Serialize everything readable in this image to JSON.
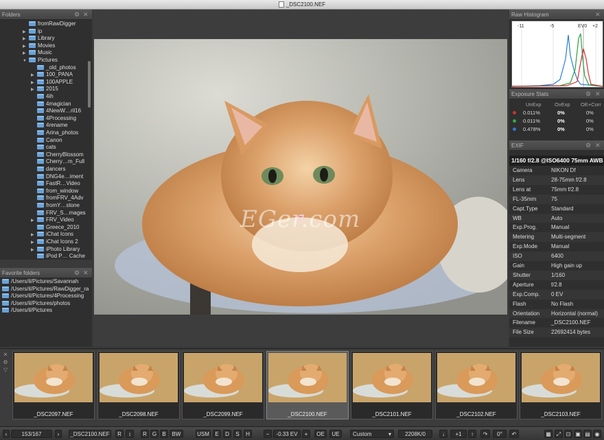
{
  "window": {
    "title": "_DSC2100.NEF"
  },
  "folders_panel": {
    "title": "Folders",
    "items": [
      {
        "label": "fromRawDigger",
        "depth": 1,
        "arrow": ""
      },
      {
        "label": "ip",
        "depth": 1,
        "arrow": "▶"
      },
      {
        "label": "Library",
        "depth": 1,
        "arrow": "▶"
      },
      {
        "label": "Movies",
        "depth": 1,
        "arrow": "▶"
      },
      {
        "label": "Music",
        "depth": 1,
        "arrow": "▶"
      },
      {
        "label": "Pictures",
        "depth": 1,
        "arrow": "▼"
      },
      {
        "label": "_old_photos",
        "depth": 2,
        "arrow": ""
      },
      {
        "label": "100_PANA",
        "depth": 2,
        "arrow": "▶"
      },
      {
        "label": "100APPLE",
        "depth": 2,
        "arrow": "▶"
      },
      {
        "label": "2015",
        "depth": 2,
        "arrow": "▶"
      },
      {
        "label": "4ih",
        "depth": 2,
        "arrow": ""
      },
      {
        "label": "4magician",
        "depth": 2,
        "arrow": ""
      },
      {
        "label": "4NewW…ril16",
        "depth": 2,
        "arrow": ""
      },
      {
        "label": "4Processing",
        "depth": 2,
        "arrow": ""
      },
      {
        "label": "4rename",
        "depth": 2,
        "arrow": ""
      },
      {
        "label": "Arina_photos",
        "depth": 2,
        "arrow": ""
      },
      {
        "label": "Canon",
        "depth": 2,
        "arrow": ""
      },
      {
        "label": "cats",
        "depth": 2,
        "arrow": ""
      },
      {
        "label": "CherryBlossom",
        "depth": 2,
        "arrow": ""
      },
      {
        "label": "Cherry…m_Full",
        "depth": 2,
        "arrow": ""
      },
      {
        "label": "dancers",
        "depth": 2,
        "arrow": ""
      },
      {
        "label": "DNG4e…iment",
        "depth": 2,
        "arrow": ""
      },
      {
        "label": "FastR…Video",
        "depth": 2,
        "arrow": ""
      },
      {
        "label": "from_window",
        "depth": 2,
        "arrow": ""
      },
      {
        "label": "fromFRV_4Adv",
        "depth": 2,
        "arrow": ""
      },
      {
        "label": "fromY…stone",
        "depth": 2,
        "arrow": ""
      },
      {
        "label": "FRV_S…mages",
        "depth": 2,
        "arrow": ""
      },
      {
        "label": "FRV_Video",
        "depth": 2,
        "arrow": "▶"
      },
      {
        "label": "Greece_2010",
        "depth": 2,
        "arrow": ""
      },
      {
        "label": "iChat Icons",
        "depth": 2,
        "arrow": "▶"
      },
      {
        "label": "iChat Icons 2",
        "depth": 2,
        "arrow": "▶"
      },
      {
        "label": "iPhoto Library",
        "depth": 2,
        "arrow": "▶"
      },
      {
        "label": "iPod P… Cache",
        "depth": 2,
        "arrow": ""
      }
    ]
  },
  "favorites_panel": {
    "title": "Favorite folders",
    "items": [
      "/Users/il/Pictures/Savannah",
      "/Users/il/Pictures/RawDigger_ra",
      "/Users/il/Pictures/4Processing",
      "/Users/il/Pictures/photos",
      "/Users/il/Pictures"
    ]
  },
  "histogram": {
    "title": "Raw Histogram",
    "scale_labels": [
      "-11",
      "-5",
      "EV0",
      "+2"
    ]
  },
  "exposure_stats": {
    "title": "Exposure Stats",
    "headers": [
      "UnExp",
      "OvExp",
      "OE+Corr"
    ],
    "rows": [
      {
        "color": "#cc3333",
        "unexp": "0.011%",
        "ovexp": "0%",
        "oecorr": "0%"
      },
      {
        "color": "#33aa44",
        "unexp": "0.011%",
        "ovexp": "0%",
        "oecorr": "0%"
      },
      {
        "color": "#3377cc",
        "unexp": "0.478%",
        "ovexp": "0%",
        "oecorr": "0%"
      }
    ]
  },
  "exif": {
    "title": "EXIF",
    "summary": "1/160 f/2.8 @ISO6400 75mm AWB",
    "rows": [
      {
        "k": "Camera",
        "v": "NIKON Df"
      },
      {
        "k": "Lens",
        "v": "28-75mm f/2.8"
      },
      {
        "k": "Lens at",
        "v": "75mm f/2.8"
      },
      {
        "k": "FL-35mm",
        "v": "75"
      },
      {
        "k": "Capt.Type",
        "v": "Standard"
      },
      {
        "k": "WB",
        "v": "Auto"
      },
      {
        "k": "Exp.Prog.",
        "v": "Manual"
      },
      {
        "k": "Metering",
        "v": "Multi-segment"
      },
      {
        "k": "Exp.Mode",
        "v": "Manual"
      },
      {
        "k": "ISO",
        "v": "6400"
      },
      {
        "k": "Gain",
        "v": "High gain up"
      },
      {
        "k": "Shutter",
        "v": "1/160"
      },
      {
        "k": "Aperture",
        "v": "f/2.8"
      },
      {
        "k": "Exp.Comp.",
        "v": "0 EV"
      },
      {
        "k": "Flash",
        "v": "No Flash"
      },
      {
        "k": "Orientation",
        "v": "Horizontal (normal)"
      },
      {
        "k": "Filename",
        "v": "_DSC2100.NEF"
      },
      {
        "k": "File Size",
        "v": "22692414 bytes"
      }
    ]
  },
  "watermark": "EGer.com",
  "filmstrip": [
    {
      "name": "_DSC2097.NEF",
      "selected": false
    },
    {
      "name": "_DSC2098.NEF",
      "selected": false
    },
    {
      "name": "_DSC2099.NEF",
      "selected": false
    },
    {
      "name": "_DSC2100.NEF",
      "selected": true
    },
    {
      "name": "_DSC2101.NEF",
      "selected": false
    },
    {
      "name": "_DSC2102.NEF",
      "selected": false
    },
    {
      "name": "_DSC2103.NEF",
      "selected": false
    }
  ],
  "bottombar": {
    "counter": "153/167",
    "filename": "_DSC2100.NEF",
    "r_btn": "R",
    "rotate_btn": "↕",
    "channels": [
      "R",
      "G",
      "B",
      "BW"
    ],
    "usm": "USM",
    "modes": [
      "E",
      "D",
      "S",
      "H"
    ],
    "ev_minus": "−",
    "ev_value": "-0.33 EV",
    "ev_plus": "+",
    "oe": "OE",
    "ue": "UE",
    "profile": "Custom",
    "cache": "2208K/0",
    "step": "+1",
    "rotation": "0°"
  }
}
